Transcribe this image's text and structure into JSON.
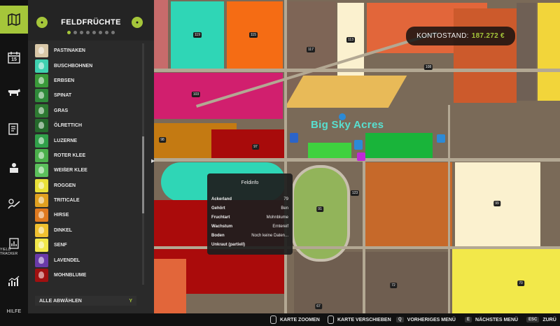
{
  "rail": {
    "items": [
      {
        "icon": "map-icon"
      },
      {
        "icon": "calendar-icon",
        "value": "15"
      },
      {
        "icon": "cow-icon"
      },
      {
        "icon": "contracts-icon"
      },
      {
        "icon": "production-icon"
      },
      {
        "icon": "finance-icon"
      },
      {
        "icon": "yield-tracker-icon",
        "label": "YIELD TRACKER"
      },
      {
        "icon": "statistics-icon"
      },
      {
        "icon": "help-icon",
        "label": "HILFE"
      }
    ]
  },
  "panel": {
    "title": "FELDFRÜCHTE",
    "page_dots": 8,
    "active_dot": 0,
    "crops": [
      {
        "label": "PASTINAKEN",
        "color": "#d9c8a8"
      },
      {
        "label": "BUSCHBOHNEN",
        "color": "#3fd1b0"
      },
      {
        "label": "ERBSEN",
        "color": "#3a9a3a"
      },
      {
        "label": "SPINAT",
        "color": "#2f8a3a"
      },
      {
        "label": "GRAS",
        "color": "#2e7a32"
      },
      {
        "label": "ÖLRETTICH",
        "color": "#256a2c"
      },
      {
        "label": "LUZERNE",
        "color": "#31a04a"
      },
      {
        "label": "ROTER KLEE",
        "color": "#4bb04b"
      },
      {
        "label": "WEIßER KLEE",
        "color": "#5cc05c"
      },
      {
        "label": "ROGGEN",
        "color": "#e8e038"
      },
      {
        "label": "TRITICALE",
        "color": "#e0a020"
      },
      {
        "label": "HIRSE",
        "color": "#e07a20"
      },
      {
        "label": "DINKEL",
        "color": "#f0c030"
      },
      {
        "label": "SENF",
        "color": "#f2e84a"
      },
      {
        "label": "LAVENDEL",
        "color": "#6a3aa8"
      },
      {
        "label": "MOHNBLUME",
        "color": "#a01010"
      }
    ],
    "deselect_label": "ALLE ABWÄHLEN",
    "deselect_key": "Y"
  },
  "map": {
    "farm_name": "Big Sky Acres",
    "field_numbers": [
      "119",
      "115",
      "117",
      "113",
      "108",
      "103",
      "98",
      "97",
      "91",
      "123",
      "99",
      "72",
      "67",
      "70"
    ]
  },
  "balance": {
    "label": "KONTOSTAND:",
    "amount": "187.272 €"
  },
  "field_info": {
    "title": "Feldinfo",
    "rows": [
      {
        "key": "Ackerland",
        "value": "79"
      },
      {
        "key": "Gehört",
        "value": "Ben"
      },
      {
        "key": "Fruchtart",
        "value": "Mohnblume"
      },
      {
        "key": "Wachstum",
        "value": "Erntereif"
      },
      {
        "key": "Boden",
        "value": "Noch keine Daten..."
      },
      {
        "key": "Unkraut (partiell)",
        "value": ""
      }
    ]
  },
  "bottom_bar": {
    "items": [
      {
        "key": "",
        "label": "KARTE ZOOMEN"
      },
      {
        "key": "",
        "label": "KARTE VERSCHIEBEN"
      },
      {
        "key": "Q",
        "label": "VORHERIGES MENÜ"
      },
      {
        "key": "E",
        "label": "NÄCHSTES MENÜ"
      },
      {
        "key": "ESC",
        "label": "ZURÜ"
      }
    ]
  },
  "colors": {
    "accent": "#a5c63a"
  }
}
